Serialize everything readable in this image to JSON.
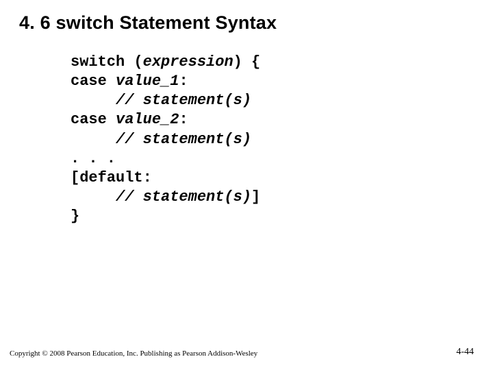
{
  "title": "4. 6 switch Statement Syntax",
  "code": {
    "l1": {
      "a": "switch (",
      "b": "expression",
      "c": ") {"
    },
    "l2": {
      "a": "case ",
      "b": "value_1",
      "c": ":"
    },
    "l3": {
      "b": "// statement(s)"
    },
    "l4": {
      "a": "case ",
      "b": "value_2",
      "c": ":"
    },
    "l5": {
      "b": "// statement(s)"
    },
    "l6": {
      "a": ". . ."
    },
    "l7": {
      "a": "[default:"
    },
    "l8": {
      "b": "// statement(s)",
      "c": "]"
    },
    "l9": {
      "a": "}"
    }
  },
  "footer": {
    "copyright": "Copyright © 2008 Pearson Education, Inc. Publishing as Pearson Addison-Wesley",
    "page": "4-44"
  }
}
